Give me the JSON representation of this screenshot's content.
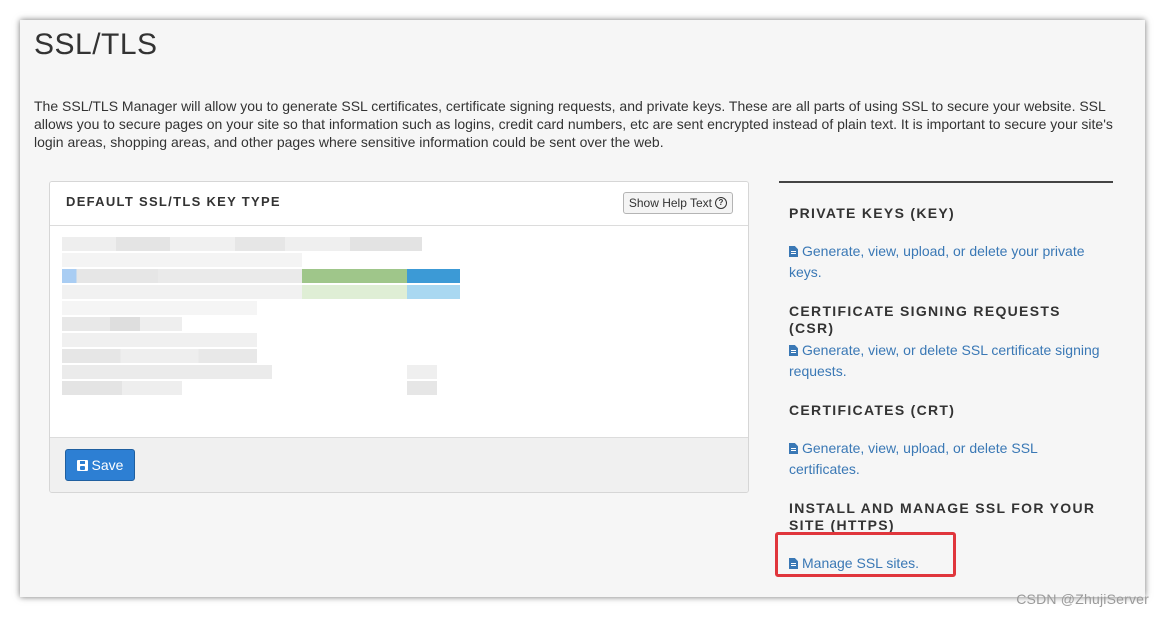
{
  "page": {
    "title": "SSL/TLS",
    "intro": "The SSL/TLS Manager will allow you to generate SSL certificates, certificate signing requests, and private keys. These are all parts of using SSL to secure your website. SSL allows you to secure pages on your site so that information such as logins, credit card numbers, etc are sent encrypted instead of plain text. It is important to secure your site's login areas, shopping areas, and other pages where sensitive information could be sent over the web."
  },
  "key_type_panel": {
    "title": "DEFAULT SSL/TLS KEY TYPE",
    "help_label": "Show Help Text",
    "help_icon": "question-circle-icon",
    "save_label": "Save",
    "save_icon": "floppy-disk-icon"
  },
  "sections": [
    {
      "title": "PRIVATE KEYS (KEY)",
      "link": "Generate, view, upload, or delete your private keys."
    },
    {
      "title": "CERTIFICATE SIGNING REQUESTS (CSR)",
      "link": "Generate, view, or delete SSL certificate signing requests."
    },
    {
      "title": "CERTIFICATES (CRT)",
      "link": "Generate, view, upload, or delete SSL certificates."
    },
    {
      "title": "INSTALL AND MANAGE SSL FOR YOUR SITE (HTTPS)",
      "link": "Manage SSL sites."
    }
  ],
  "watermark": "CSDN @ZhujiServer",
  "colors": {
    "link": "#3a78b5",
    "primary_button": "#2d7fd3",
    "highlight": "#e0363c",
    "text": "#333333"
  }
}
